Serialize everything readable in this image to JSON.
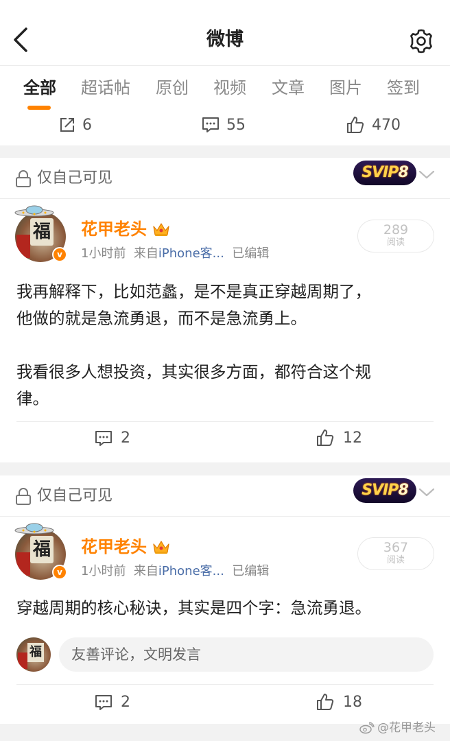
{
  "header": {
    "title": "微博"
  },
  "tabs": [
    {
      "label": "全部"
    },
    {
      "label": "超话帖"
    },
    {
      "label": "原创"
    },
    {
      "label": "视频"
    },
    {
      "label": "文章"
    },
    {
      "label": "图片"
    },
    {
      "label": "签到"
    }
  ],
  "top_stats": {
    "reposts": "6",
    "comments": "55",
    "likes": "470"
  },
  "colors": {
    "accent": "#ff8200",
    "link": "#4b6ea8"
  },
  "posts": [
    {
      "visibility": "仅自己可见",
      "svip_text": "SVIP",
      "svip_level": "8",
      "username": "花甲老头",
      "time": "1小时前",
      "from": "来自",
      "source": "iPhone客...",
      "edited": "已编辑",
      "read_count": "289",
      "read_label": "阅读",
      "content": "我再解释下，比如范蠡，是不是真正穿越周期了，\n他做的就是急流勇退，而不是急流勇上。\n\n我看很多人想投资，其实很多方面，都符合这个规\n律。",
      "comments": "2",
      "likes": "12"
    },
    {
      "visibility": "仅自己可见",
      "svip_text": "SVIP",
      "svip_level": "8",
      "username": "花甲老头",
      "time": "1小时前",
      "from": "来自",
      "source": "iPhone客...",
      "edited": "已编辑",
      "read_count": "367",
      "read_label": "阅读",
      "content": "穿越周期的核心秘诀，其实是四个字：急流勇退。",
      "comment_placeholder": "友善评论，文明发言",
      "comments": "2",
      "likes": "18"
    }
  ],
  "avatar": {
    "glyph": "福",
    "verified_glyph": "v"
  },
  "watermark": "@花甲老头",
  "icons": [
    "back-icon",
    "settings-icon",
    "repost-icon",
    "comment-icon",
    "like-icon",
    "lock-icon",
    "chevron-down-icon",
    "crown-icon",
    "weibo-logo-icon"
  ]
}
